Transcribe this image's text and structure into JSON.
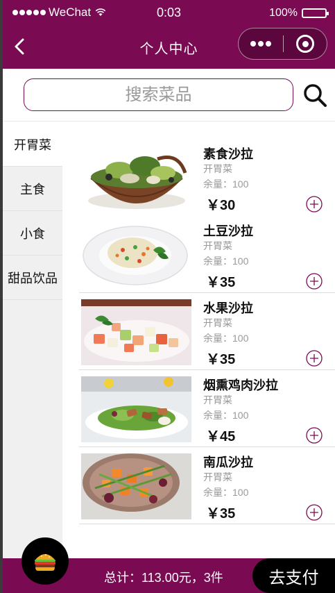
{
  "status_bar": {
    "carrier": "WeChat",
    "time": "0:03",
    "battery": "100%"
  },
  "nav": {
    "title": "个人中心"
  },
  "search": {
    "placeholder": "搜索菜品"
  },
  "categories": [
    {
      "label": "开胃菜",
      "active": true
    },
    {
      "label": "主食",
      "active": false
    },
    {
      "label": "小食",
      "active": false
    },
    {
      "label": "甜品饮品",
      "active": false
    }
  ],
  "dishes": [
    {
      "name": "素食沙拉",
      "category": "开胃菜",
      "stock": "余量：100",
      "price": "￥30"
    },
    {
      "name": "土豆沙拉",
      "category": "开胃菜",
      "stock": "余量：100",
      "price": "￥35"
    },
    {
      "name": "水果沙拉",
      "category": "开胃菜",
      "stock": "余量：100",
      "price": "￥35"
    },
    {
      "name": "烟熏鸡肉沙拉",
      "category": "开胃菜",
      "stock": "余量：100",
      "price": "￥45"
    },
    {
      "name": "南瓜沙拉",
      "category": "开胃菜",
      "stock": "余量：100",
      "price": "￥35"
    }
  ],
  "footer": {
    "total": "总计：113.00元，3件",
    "pay_label": "去支付"
  },
  "colors": {
    "brand": "#7a0a52",
    "pay_button": "#000000"
  }
}
